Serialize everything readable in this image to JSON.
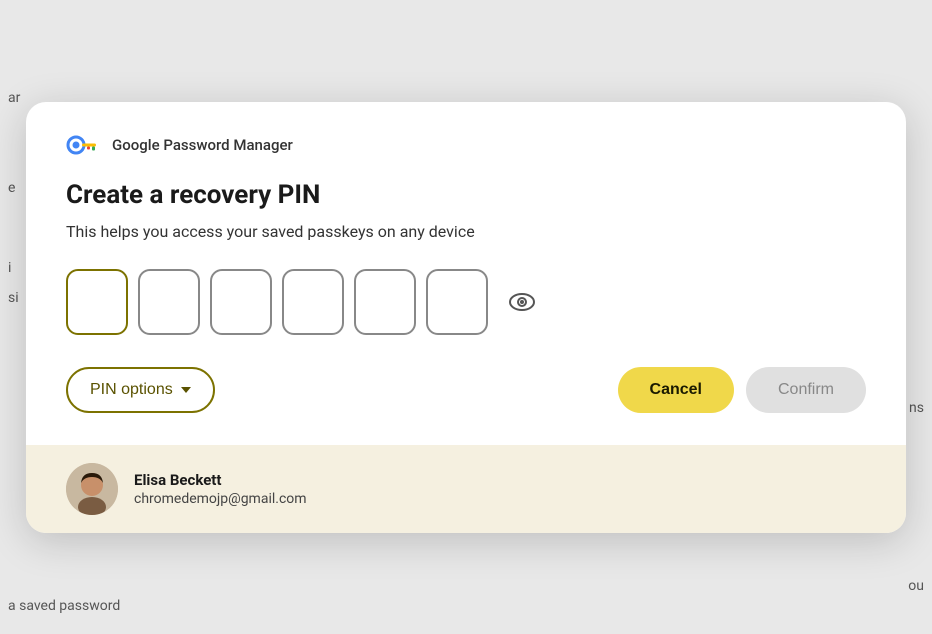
{
  "dialog": {
    "app_name": "Google Password Manager",
    "title": "Create a recovery PIN",
    "subtitle": "This helps you access your saved passkeys on any device",
    "pin_inputs": [
      {
        "id": 1,
        "value": "",
        "placeholder": ""
      },
      {
        "id": 2,
        "value": "",
        "placeholder": ""
      },
      {
        "id": 3,
        "value": "",
        "placeholder": ""
      },
      {
        "id": 4,
        "value": "",
        "placeholder": ""
      },
      {
        "id": 5,
        "value": "",
        "placeholder": ""
      },
      {
        "id": 6,
        "value": "",
        "placeholder": ""
      }
    ],
    "buttons": {
      "pin_options_label": "PIN options",
      "cancel_label": "Cancel",
      "confirm_label": "Confirm"
    },
    "footer": {
      "account_name": "Elisa Beckett",
      "account_email": "chromedemojp@gmail.com"
    }
  }
}
